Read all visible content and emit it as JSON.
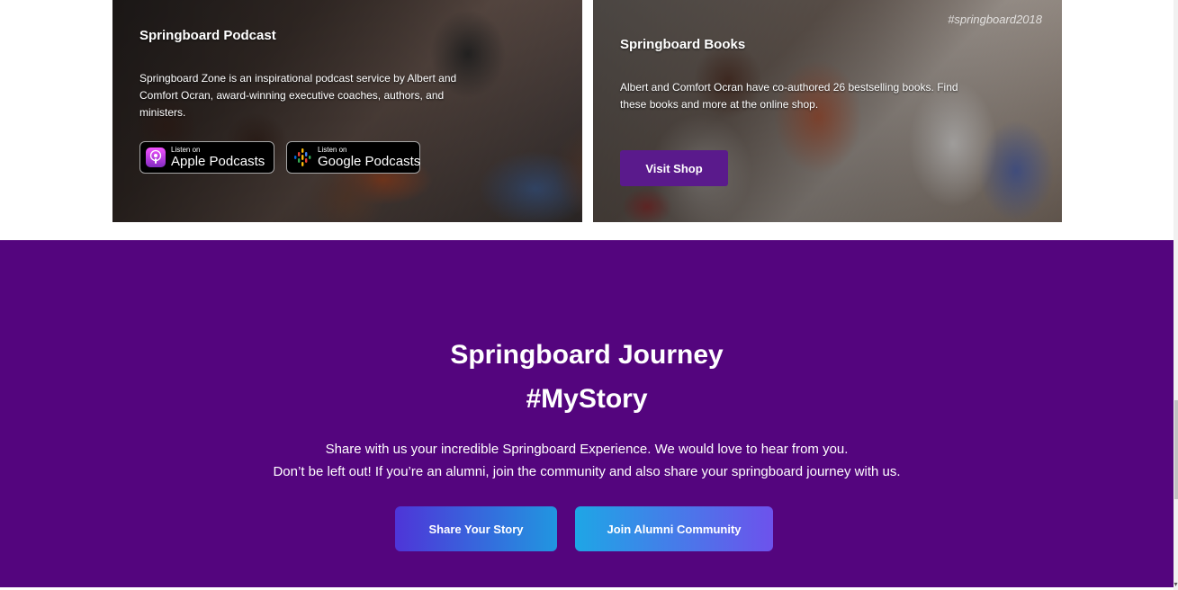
{
  "podcast_card": {
    "title": "Springboard Podcast",
    "description": "Springboard Zone is an inspirational podcast service by Albert and Comfort Ocran, award-winning executive coaches, authors, and ministers.",
    "apple_badge": {
      "small": "Listen on",
      "big": "Apple Podcasts"
    },
    "google_badge": {
      "small": "Listen on",
      "big": "Google Podcasts"
    }
  },
  "books_card": {
    "title": "Springboard Books",
    "description": "Albert and Comfort Ocran have co-authored 26 bestselling books. Find these books and more at the online shop.",
    "watermark": "#springboard2018",
    "button_label": "Visit Shop"
  },
  "journey": {
    "title_line1": "Springboard Journey",
    "title_line2": "#MyStory",
    "text_line1": "Share with us your incredible Springboard Experience. We would love to hear from you.",
    "text_line2": "Don’t be left out! If you’re an alumni, join the community and also share your springboard journey with us.",
    "share_button": "Share Your Story",
    "alumni_button": "Join Alumni Community"
  },
  "colors": {
    "purple_section": "#54057e",
    "shop_button": "#5a1a8c"
  },
  "icons": {
    "apple": "apple-podcasts-icon",
    "google": "google-podcasts-icon"
  }
}
